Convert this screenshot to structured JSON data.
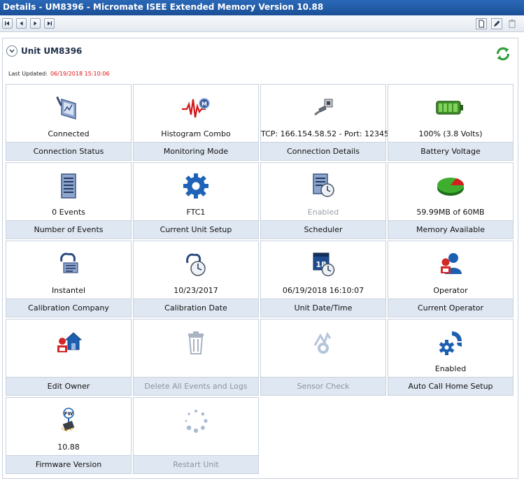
{
  "window": {
    "title": "Details - UM8396 - Micromate  ISEE Extended Memory Version 10.88"
  },
  "unit": {
    "title": "Unit UM8396",
    "last_updated_label": "Last Updated:",
    "last_updated_value": "06/19/2018 15:10:06"
  },
  "colors": {
    "title_bar": "#1b4f96",
    "tile_label_bg": "#dfe7f2",
    "timestamp": "#e01010",
    "refresh": "#2e9e3a"
  },
  "tiles": [
    {
      "icon": "connection-status-icon",
      "value": "Connected",
      "label": "Connection Status",
      "enabled": true
    },
    {
      "icon": "monitoring-waveform-icon",
      "value": "Histogram Combo",
      "label": "Monitoring Mode",
      "enabled": true
    },
    {
      "icon": "network-plug-icon",
      "value": "TCP: 166.154.58.52 - Port: 12345",
      "label": "Connection Details",
      "enabled": true
    },
    {
      "icon": "battery-icon",
      "value": "100% (3.8 Volts)",
      "label": "Battery Voltage",
      "enabled": true
    },
    {
      "icon": "document-list-icon",
      "value": "0 Events",
      "label": "Number of Events",
      "enabled": true
    },
    {
      "icon": "gear-icon",
      "value": "FTC1",
      "label": "Current Unit Setup",
      "enabled": true
    },
    {
      "icon": "schedule-clock-icon",
      "value": "Enabled",
      "label": "Scheduler",
      "enabled": true
    },
    {
      "icon": "pie-chart-icon",
      "value": "59.99MB of 60MB",
      "label": "Memory Available",
      "enabled": true
    },
    {
      "icon": "calibration-clamp-icon",
      "value": "Instantel",
      "label": "Calibration Company",
      "enabled": true
    },
    {
      "icon": "calibration-date-clock-icon",
      "value": "10/23/2017",
      "label": "Calibration Date",
      "enabled": true
    },
    {
      "icon": "calendar-clock-icon",
      "value": "06/19/2018 16:10:07",
      "label": "Unit Date/Time",
      "enabled": true
    },
    {
      "icon": "operator-user-icon",
      "value": "Operator",
      "label": "Current Operator",
      "enabled": true
    },
    {
      "icon": "owner-house-icon",
      "value": "",
      "label": "Edit Owner",
      "enabled": true
    },
    {
      "icon": "trash-can-icon",
      "value": "",
      "label": "Delete All Events and Logs",
      "enabled": false
    },
    {
      "icon": "sensor-check-icon",
      "value": "",
      "label": "Sensor Check",
      "enabled": false
    },
    {
      "icon": "phone-gear-icon",
      "value": "Enabled",
      "label": "Auto Call Home Setup",
      "enabled": true
    },
    {
      "icon": "firmware-chip-icon",
      "value": "10.88",
      "label": "Firmware Version",
      "enabled": true
    },
    {
      "icon": "loading-spinner-icon",
      "value": "",
      "label": "Restart Unit",
      "enabled": false
    }
  ]
}
